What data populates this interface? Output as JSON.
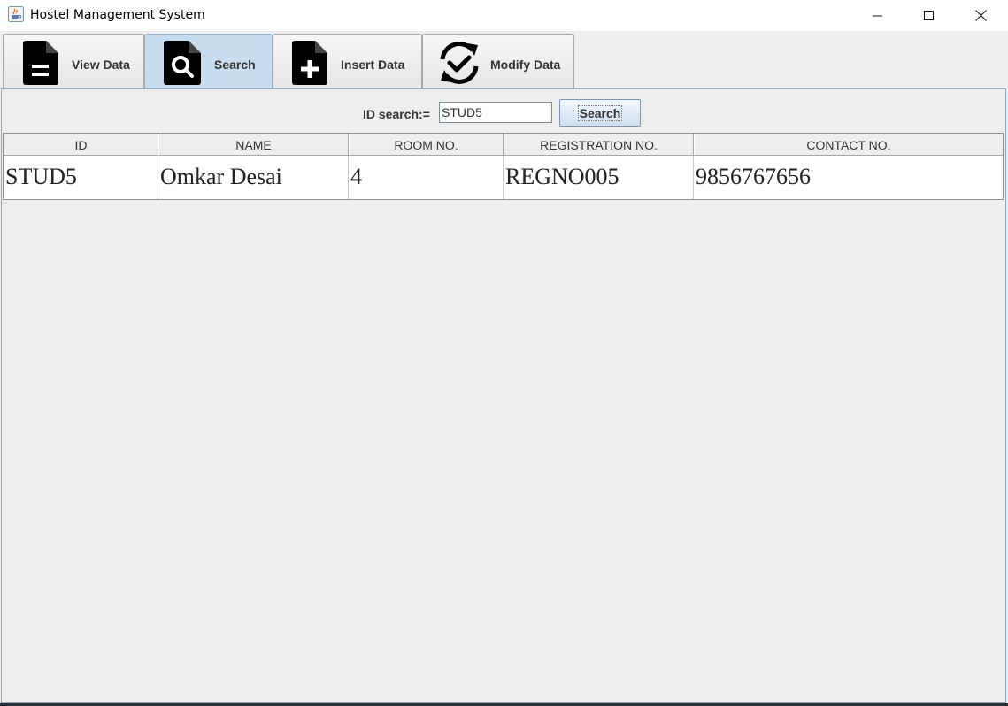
{
  "window": {
    "title": "Hostel Management System",
    "app_icon": "java-cup-icon",
    "controls": [
      "minimize-icon",
      "maximize-icon",
      "close-icon"
    ]
  },
  "tabs": [
    {
      "label": "View Data",
      "icon": "document-icon",
      "selected": false
    },
    {
      "label": "Search",
      "icon": "search-document-icon",
      "selected": true
    },
    {
      "label": "Insert Data",
      "icon": "add-document-icon",
      "selected": false
    },
    {
      "label": "Modify Data",
      "icon": "refresh-check-icon",
      "selected": false
    }
  ],
  "search": {
    "label": "ID search:=",
    "value": "STUD5",
    "button_label": "Search"
  },
  "table": {
    "columns": [
      "ID",
      "NAME",
      "ROOM NO.",
      "REGISTRATION NO.",
      "CONTACT NO."
    ],
    "rows": [
      [
        "STUD5",
        "Omkar Desai",
        "4",
        "REGNO005",
        "9856767656"
      ]
    ]
  },
  "colors": {
    "selected_tab": "#c8dcf0",
    "background": "#eeeeee"
  }
}
